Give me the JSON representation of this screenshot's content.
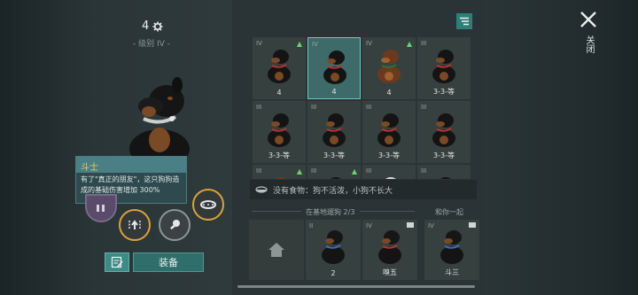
{
  "dog_profile": {
    "level": "4",
    "tier_label": "- 级别 IV -"
  },
  "tooltip": {
    "title": "斗士",
    "body": "有了\"真正的朋友\"，这只狗狗造成的基础伤害增加 300%"
  },
  "buttons": {
    "equip_label": "装备",
    "close_label": "关闭"
  },
  "grid_dogs": [
    {
      "tier": "IV",
      "label": "4",
      "arrow": "up",
      "coat": "rottweiler",
      "selected": false
    },
    {
      "tier": "IV",
      "label": "4",
      "arrow": "",
      "coat": "rottweiler",
      "selected": true
    },
    {
      "tier": "IV",
      "label": "4",
      "arrow": "up",
      "coat": "brown",
      "selected": false
    },
    {
      "tier": "III",
      "label": "3-3-等",
      "arrow": "",
      "coat": "rottweiler",
      "selected": false
    },
    {
      "tier": "III",
      "label": "3-3-等",
      "arrow": "",
      "coat": "rottweiler",
      "selected": false
    },
    {
      "tier": "III",
      "label": "3-3-等",
      "arrow": "",
      "coat": "rottweiler",
      "selected": false
    },
    {
      "tier": "III",
      "label": "3-3-等",
      "arrow": "",
      "coat": "rottweiler",
      "selected": false
    },
    {
      "tier": "III",
      "label": "3-3-等",
      "arrow": "",
      "coat": "rottweiler",
      "selected": false
    },
    {
      "tier": "III",
      "label": "",
      "arrow": "up",
      "coat": "brown",
      "selected": false
    },
    {
      "tier": "III",
      "label": "",
      "arrow": "up",
      "coat": "rottweiler",
      "selected": false
    },
    {
      "tier": "III",
      "label": "",
      "arrow": "",
      "coat": "white",
      "selected": false
    },
    {
      "tier": "III",
      "label": "",
      "arrow": "",
      "coat": "rottweiler",
      "selected": false
    }
  ],
  "food_status": "没有食物：狗不活泼，小狗不长大",
  "base_section": {
    "title": "在基地遛狗",
    "count": "2/3"
  },
  "with_you_section": {
    "title": "和你一起"
  },
  "base_dogs": [
    {
      "tier": "II",
      "label": "2"
    },
    {
      "tier": "IV",
      "label": "嗅五"
    }
  ],
  "with_you_dog": {
    "tier": "IV",
    "label": "斗三"
  },
  "colors": {
    "accent": "#3e8a85",
    "selected_border": "#6ec5bd",
    "gold_ring": "#d9a33a",
    "upgrade_arrow": "#6ecf74",
    "tooltip_title": "#f3c766"
  }
}
